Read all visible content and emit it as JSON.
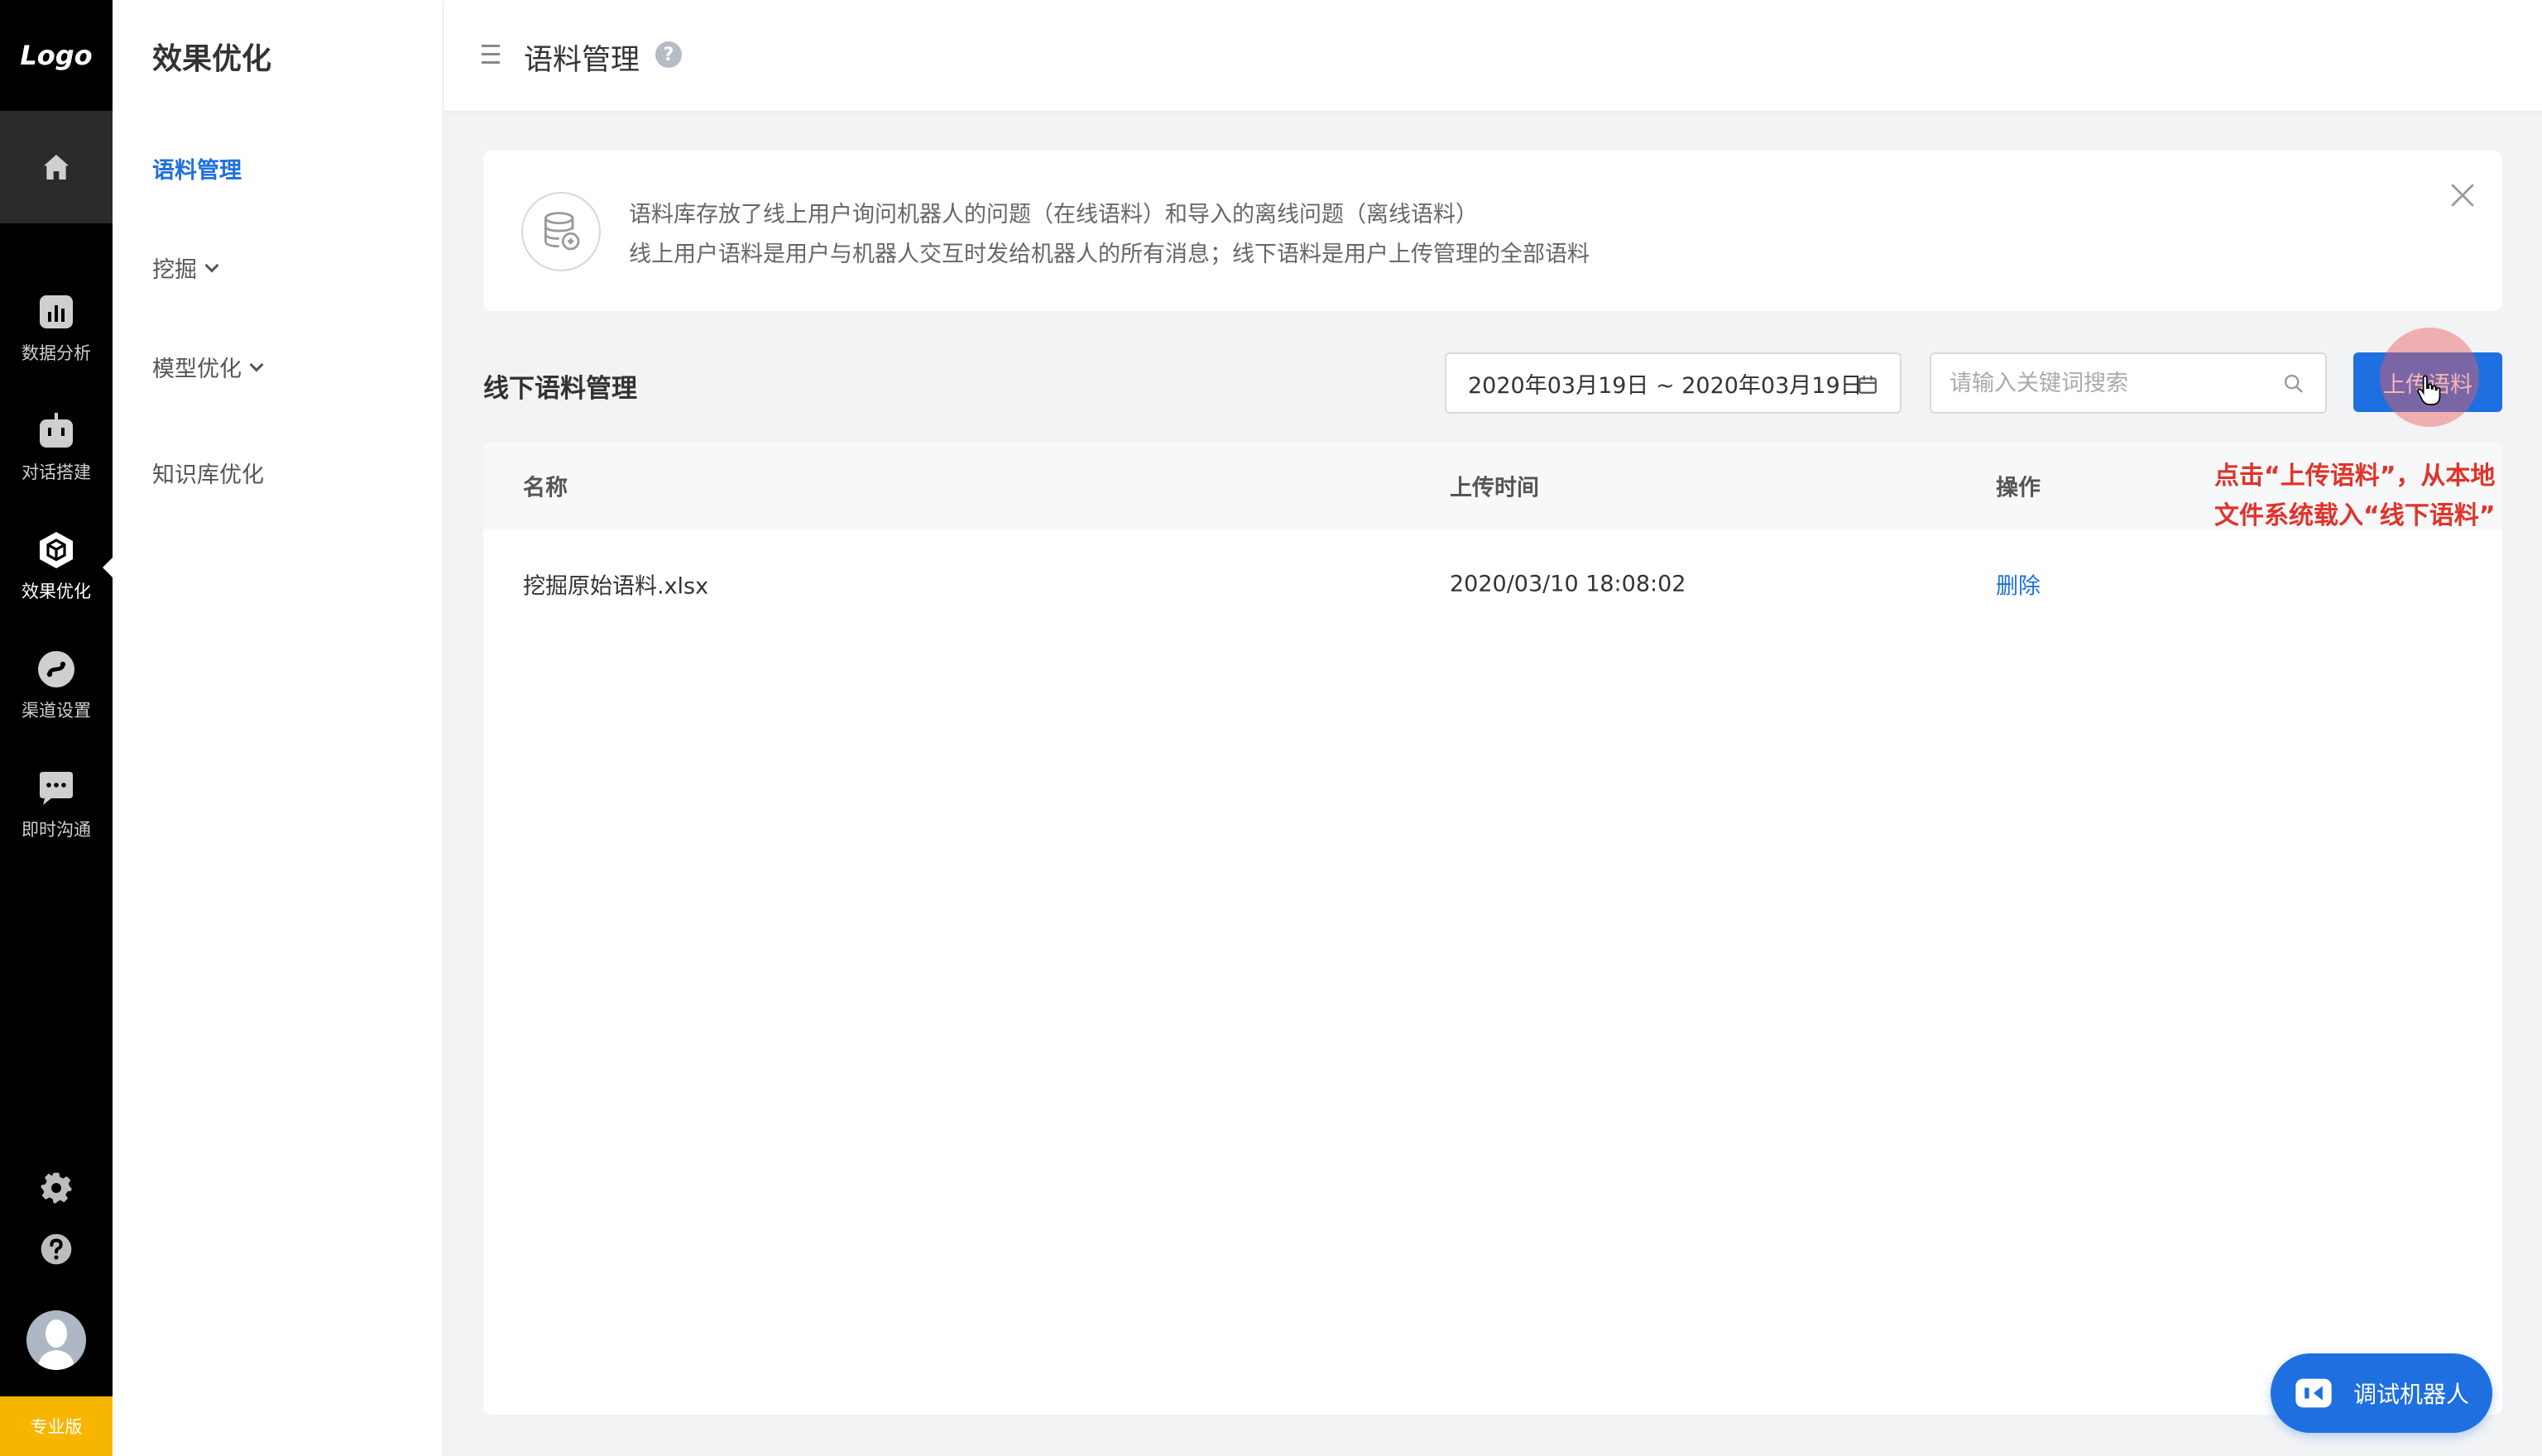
{
  "rail": {
    "logo": "Logo",
    "items": [
      {
        "label": "数据分析",
        "icon": "bar-chart-icon"
      },
      {
        "label": "对话搭建",
        "icon": "robot-icon"
      },
      {
        "label": "效果优化",
        "icon": "cube-icon"
      },
      {
        "label": "渠道设置",
        "icon": "channel-icon"
      },
      {
        "label": "即时沟通",
        "icon": "chat-icon"
      }
    ],
    "active_item": "效果优化",
    "badge": "专业版"
  },
  "submenu": {
    "title": "效果优化",
    "items": [
      {
        "label": "语料管理"
      },
      {
        "label": "挖掘"
      },
      {
        "label": "模型优化"
      },
      {
        "label": "知识库优化"
      }
    ]
  },
  "header": {
    "title": "语料管理"
  },
  "info": {
    "line1": "语料库存放了线上用户询问机器人的问题（在线语料）和导入的离线问题（离线语料）",
    "line2": "线上用户语料是用户与机器人交互时发给机器人的所有消息；线下语料是用户上传管理的全部语料"
  },
  "toolbar": {
    "section_title": "线下语料管理",
    "date_range": "2020年03月19日 ~ 2020年03月19日",
    "search_placeholder": "请输入关键词搜索",
    "upload_label": "上传语料"
  },
  "table": {
    "columns": [
      "名称",
      "上传时间",
      "操作"
    ],
    "rows": [
      {
        "name": "挖掘原始语料.xlsx",
        "time": "2020/03/10 18:08:02",
        "op": "删除"
      }
    ]
  },
  "annotation": {
    "line1": "点击“上传语料”，从本地",
    "line2": "文件系统载入“线下语料”"
  },
  "bot": {
    "label": "调试机器人"
  },
  "colors": {
    "primary": "#1e6fe0",
    "annotation": "#e0332a",
    "badge": "#f7b500"
  }
}
